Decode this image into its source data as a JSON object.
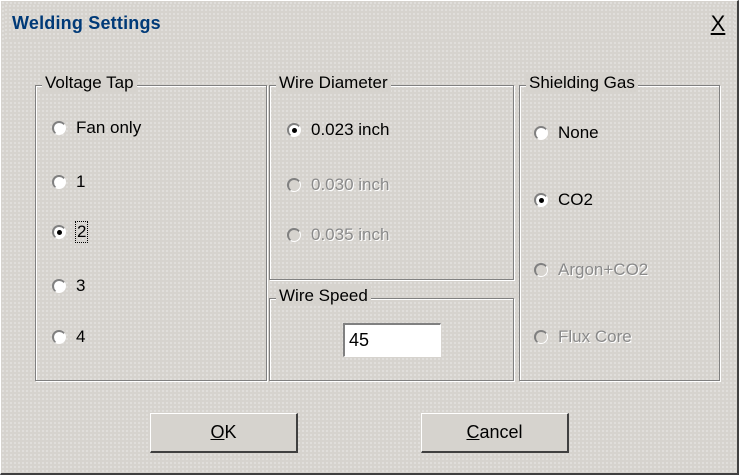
{
  "window": {
    "title": "Welding Settings",
    "close_label": "X"
  },
  "voltage_tap": {
    "legend": "Voltage Tap",
    "options": [
      {
        "label": "Fan only",
        "checked": false,
        "disabled": false
      },
      {
        "label": "1",
        "checked": false,
        "disabled": false
      },
      {
        "label": "2",
        "checked": true,
        "disabled": false
      },
      {
        "label": "3",
        "checked": false,
        "disabled": false
      },
      {
        "label": "4",
        "checked": false,
        "disabled": false
      }
    ]
  },
  "wire_diameter": {
    "legend": "Wire Diameter",
    "options": [
      {
        "label": "0.023 inch",
        "checked": true,
        "disabled": false
      },
      {
        "label": "0.030 inch",
        "checked": false,
        "disabled": true
      },
      {
        "label": "0.035 inch",
        "checked": false,
        "disabled": true
      }
    ]
  },
  "wire_speed": {
    "legend": "Wire Speed",
    "value": "45"
  },
  "shielding_gas": {
    "legend": "Shielding Gas",
    "options": [
      {
        "label": "None",
        "checked": false,
        "disabled": false
      },
      {
        "label": "CO2",
        "checked": true,
        "disabled": false
      },
      {
        "label": "Argon+CO2",
        "checked": false,
        "disabled": true
      },
      {
        "label": "Flux Core",
        "checked": false,
        "disabled": true
      }
    ]
  },
  "buttons": {
    "ok_label": "OK",
    "cancel_label": "Cancel"
  },
  "colors": {
    "face": "#d6d3ce",
    "title_text": "#003a78",
    "disabled_text": "#8a8a8a"
  }
}
